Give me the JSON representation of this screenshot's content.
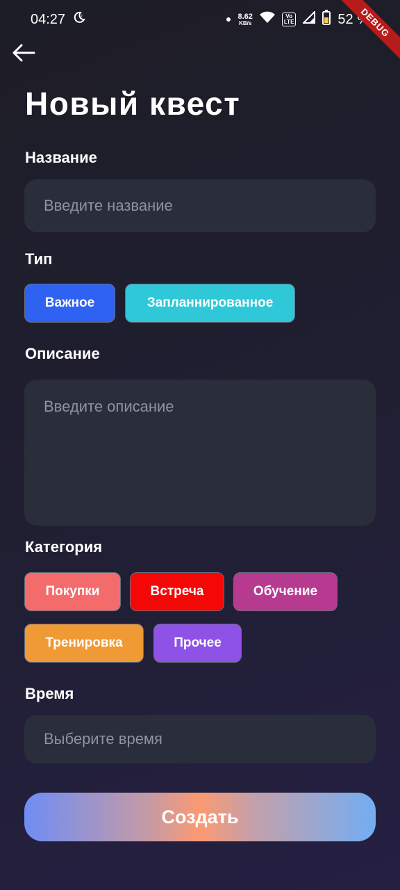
{
  "status_bar": {
    "time": "04:27",
    "net_speed_value": "8.62",
    "net_speed_unit": "KB/s",
    "volte_top": "Vo",
    "volte_bottom": "LTE",
    "battery": "52 %"
  },
  "debug_banner": "DEBUG",
  "header": {
    "title": "Новый квест"
  },
  "form": {
    "name": {
      "label": "Название",
      "placeholder": "Введите название"
    },
    "type": {
      "label": "Тип",
      "options": [
        {
          "label": "Важное",
          "color": "#2f62f3"
        },
        {
          "label": "Запланнированное",
          "color": "#2ec8d8"
        }
      ]
    },
    "description": {
      "label": "Описание",
      "placeholder": "Введите описание"
    },
    "category": {
      "label": "Категория",
      "options": [
        {
          "label": "Покупки",
          "color": "#f36b6b"
        },
        {
          "label": "Встреча",
          "color": "#f50707"
        },
        {
          "label": "Обучение",
          "color": "#b63a8f"
        },
        {
          "label": "Тренировка",
          "color": "#ef9a35"
        },
        {
          "label": "Прочее",
          "color": "#8f52e6"
        }
      ]
    },
    "time": {
      "label": "Время",
      "placeholder": "Выберите время"
    },
    "submit_label": "Создать"
  },
  "icons": {
    "back": "arrow-left-icon",
    "dnd": "moon-icon",
    "wifi": "wifi-icon",
    "signal": "signal-icon",
    "battery": "battery-icon"
  }
}
